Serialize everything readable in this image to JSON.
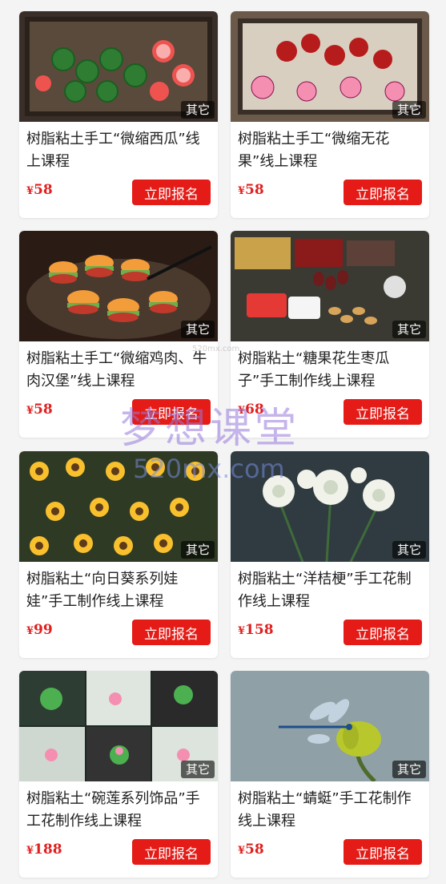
{
  "products": [
    {
      "title": "树脂粘土手工“微缩西瓜”线上课程",
      "tag": "其它",
      "currency": "¥",
      "price": "58",
      "button": "立即报名",
      "image": "miniature-watermelon-photo"
    },
    {
      "title": "树脂粘土手工“微缩无花果”线上课程",
      "tag": "其它",
      "currency": "¥",
      "price": "58",
      "button": "立即报名",
      "image": "miniature-fig-photo"
    },
    {
      "title": "树脂粘土手工“微缩鸡肉、牛肉汉堡”线上课程",
      "tag": "其它",
      "currency": "¥",
      "price": "58",
      "button": "立即报名",
      "image": "miniature-burger-photo"
    },
    {
      "title": "树脂粘土“糖果花生枣瓜子”手工制作线上课程",
      "tag": "其它",
      "currency": "¥",
      "price": "68",
      "button": "立即报名",
      "image": "candy-peanut-photo"
    },
    {
      "title": "树脂粘土“向日葵系列娃娃”手工制作线上课程",
      "tag": "其它",
      "currency": "¥",
      "price": "99",
      "button": "立即报名",
      "image": "sunflower-doll-photo"
    },
    {
      "title": "树脂粘土“洋桔梗”手工花制作线上课程",
      "tag": "其它",
      "currency": "¥",
      "price": "158",
      "button": "立即报名",
      "image": "eustoma-flower-photo"
    },
    {
      "title": "树脂粘土“碗莲系列饰品”手工花制作线上课程",
      "tag": "其它",
      "currency": "¥",
      "price": "188",
      "button": "立即报名",
      "image": "lotus-jewelry-photo"
    },
    {
      "title": "树脂粘土“蜻蜓”手工花制作线上课程",
      "tag": "其它",
      "currency": "¥",
      "price": "58",
      "button": "立即报名",
      "image": "dragonfly-photo"
    }
  ],
  "watermark": {
    "main": "梦想课堂",
    "url": "520mx.com",
    "small": "520mx.com"
  },
  "colors": {
    "accent": "#e41b16",
    "price": "#e0201f",
    "background": "#f4f4f4"
  }
}
